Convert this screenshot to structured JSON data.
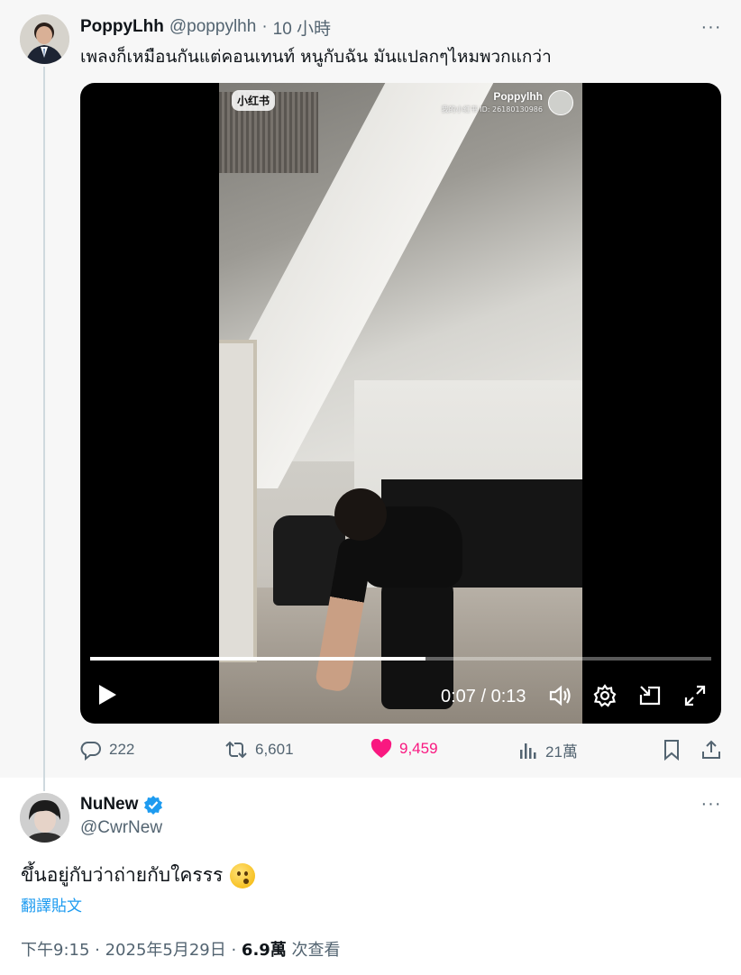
{
  "tweet": {
    "display_name": "PoppyLhh",
    "handle": "@poppylhh",
    "separator": "·",
    "time": "10 小時",
    "text": "เพลงก็เหมือนกันแต่คอนเทนท์ หนูกับฉัน มันแปลกๆไหมพวกแกว่า",
    "more_icon": "···",
    "video": {
      "watermark_logo": "小红书",
      "watermark_name": "Poppylhh",
      "watermark_id": "我的小红书 ID: 26180130986",
      "progress_fraction": 0.54,
      "time_readout": "0:07 / 0:13"
    },
    "stats": {
      "replies": "222",
      "retweets": "6,601",
      "likes": "9,459",
      "views": "21萬"
    },
    "colors": {
      "like": "#f91880",
      "muted": "#536471"
    }
  },
  "reply": {
    "display_name": "NuNew",
    "handle": "@CwrNew",
    "verified": true,
    "text": "ขึ้นอยู่กับว่าถ่ายกับใครรร",
    "emoji": "kissing-face-emoji",
    "translate_label": "翻譯貼文",
    "meta_time": "下午9:15 · 2025年5月29日 · ",
    "meta_views": "6.9萬",
    "meta_views_suffix": " 次查看",
    "colors": {
      "link": "#1d9bf0",
      "verified": "#1d9bf0"
    }
  }
}
